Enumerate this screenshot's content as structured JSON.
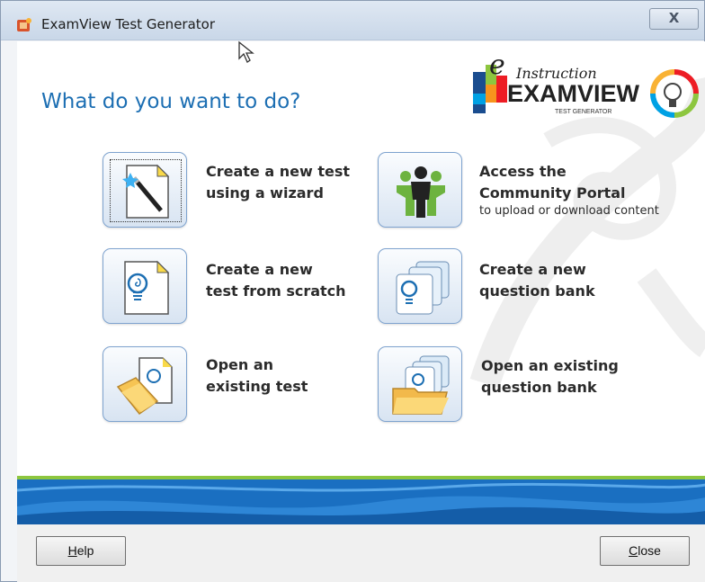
{
  "window": {
    "title": "ExamView Test Generator",
    "close_glyph": "X"
  },
  "main": {
    "heading": "What do you want to do?"
  },
  "logo": {
    "brand_small": "Instruction",
    "brand_e": "e",
    "brand_main": "EXAMVIEW",
    "brand_sub": "TEST GENERATOR"
  },
  "options": [
    {
      "line1": "Create a new test",
      "line2": "using a wizard",
      "icon": "wizard-wand-icon"
    },
    {
      "line1": "Access the",
      "line2": "Community Portal",
      "sub": "to upload or download content",
      "icon": "community-people-icon"
    },
    {
      "line1": "Create a new",
      "line2": "test from scratch",
      "icon": "new-test-document-icon"
    },
    {
      "line1": "Create a new",
      "line2": "question bank",
      "icon": "question-bank-stack-icon"
    },
    {
      "line1": "Open an",
      "line2": "existing test",
      "icon": "open-folder-test-icon"
    },
    {
      "line1": "Open an existing",
      "line2": "question bank",
      "icon": "open-folder-bank-icon"
    }
  ],
  "footer": {
    "help_mnemonic": "H",
    "help_rest": "elp",
    "close_mnemonic": "C",
    "close_rest": "lose"
  },
  "colors": {
    "heading_blue": "#1d6fb3",
    "accent_green": "#8dc63f",
    "banner_blue": "#1a6fc1"
  }
}
